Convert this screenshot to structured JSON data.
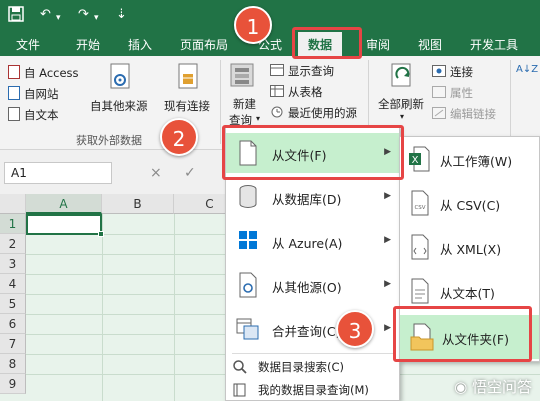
{
  "title_bar": {
    "icons": [
      "save-icon",
      "undo-icon",
      "redo-icon",
      "customize-icon"
    ]
  },
  "tabs": {
    "file": "文件",
    "home": "开始",
    "insert": "插入",
    "layout": "页面布局",
    "formulas": "公式",
    "data": "数据",
    "review": "审阅",
    "view": "视图",
    "developer": "开发工具",
    "active": "数据"
  },
  "badges": {
    "one": "1",
    "two": "2",
    "three": "3"
  },
  "ribbon": {
    "from_access": "自 Access",
    "from_web": "自网站",
    "from_text": "自文本",
    "other_sources": "自其他来源",
    "existing_connections": "现有连接",
    "get_external_group": "获取外部数据",
    "new_query_line1": "新建",
    "new_query_line2": "查询",
    "show_queries": "显示查询",
    "from_table": "从表格",
    "recent_sources": "最近使用的源",
    "refresh_all": "全部刷新",
    "connections": "连接",
    "properties": "属性",
    "edit_links": "编辑链接",
    "sort_az": "A↓Z"
  },
  "formula_bar": {
    "name_box": "A1",
    "cancel_icon": "×",
    "enter_icon": "✓"
  },
  "grid": {
    "columns": [
      "A",
      "B",
      "C"
    ],
    "rows": [
      "1",
      "2",
      "3",
      "4",
      "5",
      "6",
      "7",
      "8",
      "9"
    ]
  },
  "menu_new_query": {
    "items": [
      {
        "label": "从文件(F)",
        "highlighted": true
      },
      {
        "label": "从数据库(D)"
      },
      {
        "label": "从 Azure(A)"
      },
      {
        "label": "从其他源(O)"
      },
      {
        "label": "合并查询(C)"
      },
      {
        "label": "数据目录搜索(C)"
      },
      {
        "label": "我的数据目录查询(M)"
      }
    ]
  },
  "menu_from_file": {
    "items": [
      {
        "label": "从工作簿(W)"
      },
      {
        "label": "从 CSV(C)"
      },
      {
        "label": "从 XML(X)"
      },
      {
        "label": "从文本(T)"
      },
      {
        "label": "从文件夹(F)",
        "highlighted": true
      }
    ]
  },
  "watermark": "悟空问答",
  "colors": {
    "excel_green": "#217346",
    "highlight_green": "#c6efce",
    "annotation_red": "#e64545"
  }
}
